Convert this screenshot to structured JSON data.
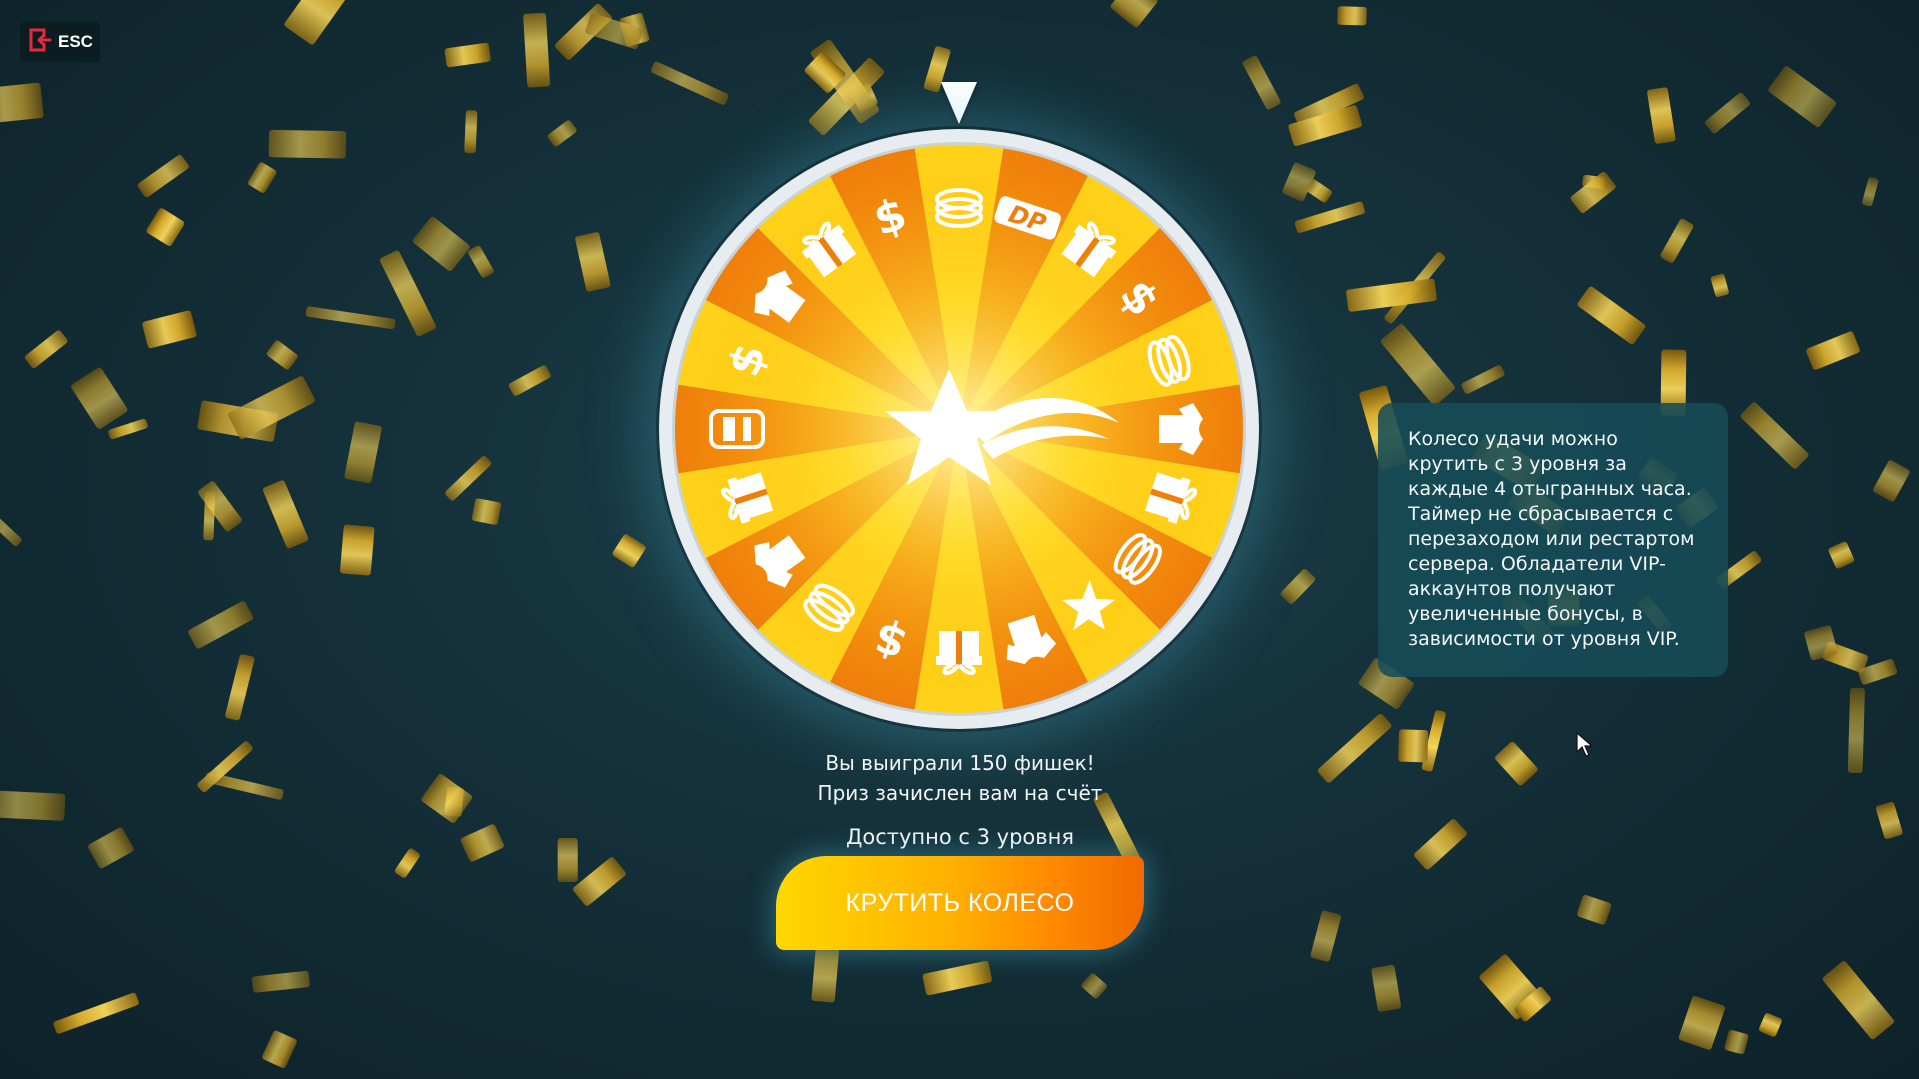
{
  "esc": {
    "label": "ESC",
    "icon": "exit-door-icon",
    "icon_color": "#e8283c"
  },
  "wheel": {
    "center_icon": "shooting-star-icon",
    "pointer_icon": "triangle-pointer-icon",
    "segments": [
      {
        "icon": "coins-icon"
      },
      {
        "icon": "dp-logo-icon"
      },
      {
        "icon": "gift-box-icon"
      },
      {
        "icon": "dollar-icon"
      },
      {
        "icon": "coins-icon"
      },
      {
        "icon": "tshirt-icon"
      },
      {
        "icon": "gift-box-icon"
      },
      {
        "icon": "coins-icon"
      },
      {
        "icon": "star-badge-icon"
      },
      {
        "icon": "tshirt-icon"
      },
      {
        "icon": "gift-box-icon"
      },
      {
        "icon": "dollar-icon"
      },
      {
        "icon": "coins-icon"
      },
      {
        "icon": "tshirt-icon"
      },
      {
        "icon": "gift-box-icon"
      },
      {
        "icon": "car-icon"
      },
      {
        "icon": "dollar-icon"
      },
      {
        "icon": "tshirt-icon"
      },
      {
        "icon": "gift-box-icon"
      },
      {
        "icon": "dollar-icon"
      }
    ],
    "colors": {
      "rim": "#e6ecef",
      "dark": "#ef7f0c",
      "light": "#ffd21a",
      "center": "#fff6b0"
    }
  },
  "result": {
    "line1": "Вы выиграли 150 фишек!",
    "line2": "Приз зачислен вам на счёт"
  },
  "availability": "Доступно с 3 уровня",
  "spin_button": {
    "label": "КРУТИТЬ КОЛЕСО"
  },
  "info": {
    "text": "Колесо удачи можно крутить с 3 уровня за каждые 4 отыгранных часа. Таймер не сбрасывается с перезаходом или рестартом сервера. Обладатели VIP-аккаунтов получают увеличенные бонусы, в зависимости от уровня VIP."
  }
}
